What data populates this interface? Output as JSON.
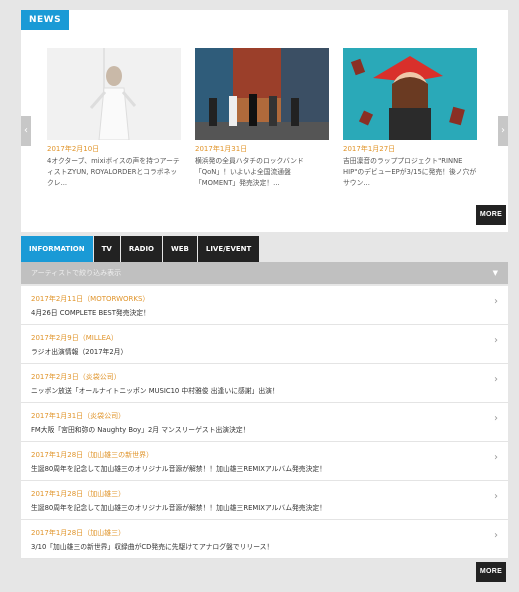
{
  "news": {
    "tag": "NEWS",
    "left_arrow": "‹",
    "right_arrow": "›",
    "more_label": "MORE",
    "items": [
      {
        "date": "2017年2月10日",
        "text": "4オクターブ、mixiボイスの声を持つアーティストZYUN, ROYALORDERとコラボネックレ..."
      },
      {
        "date": "2017年1月31日",
        "text": "横浜発の全員ハタチのロックバンド「QoN」！いよいよ全国流通盤「MOMENT」発売決定！..."
      },
      {
        "date": "2017年1月27日",
        "text": "吉田凜音のラッププロジェクト\"RINNE HIP\"のデビューEPが3/15に発売！後ノ穴がサウン..."
      }
    ]
  },
  "info": {
    "tabs": [
      "INFORMATION",
      "TV",
      "RADIO",
      "WEB",
      "LIVE/EVENT"
    ],
    "filter_label": "アーティストで絞り込み表示",
    "filter_caret": "▼",
    "chevron": "›",
    "more_label": "MORE",
    "items": [
      {
        "date": "2017年2月11日（MOTORWORKS）",
        "title": "4月26日 COMPLETE BEST発売決定！"
      },
      {
        "date": "2017年2月9日（MILLEA）",
        "title": "ラジオ出演情報（2017年2月）"
      },
      {
        "date": "2017年2月3日（炎袋公司）",
        "title": "ニッポン放送「オールナイトニッポン MUSIC10 中村雅俊 出逢いに感謝」出演！"
      },
      {
        "date": "2017年1月31日（炎袋公司）",
        "title": "FM大阪「宮田和弥の Naughty Boy」2月 マンスリーゲスト出演決定！"
      },
      {
        "date": "2017年1月28日（加山雄三の新世界）",
        "title": "生誕80周年を記念して加山雄三のオリジナル音源が解禁！！加山雄三REMIXアルバム発売決定！"
      },
      {
        "date": "2017年1月28日（加山雄三）",
        "title": "生誕80周年を記念して加山雄三のオリジナル音源が解禁！！加山雄三REMIXアルバム発売決定！"
      },
      {
        "date": "2017年1月28日（加山雄三）",
        "title": "3/10「加山雄三の新世界」収録曲がCD発売に先駆けてアナログ盤でリリース！"
      }
    ]
  },
  "colors": {
    "accent": "#1a9ad6",
    "date": "#e0942a",
    "dark": "#222222",
    "filter": "#c0c0c0"
  }
}
